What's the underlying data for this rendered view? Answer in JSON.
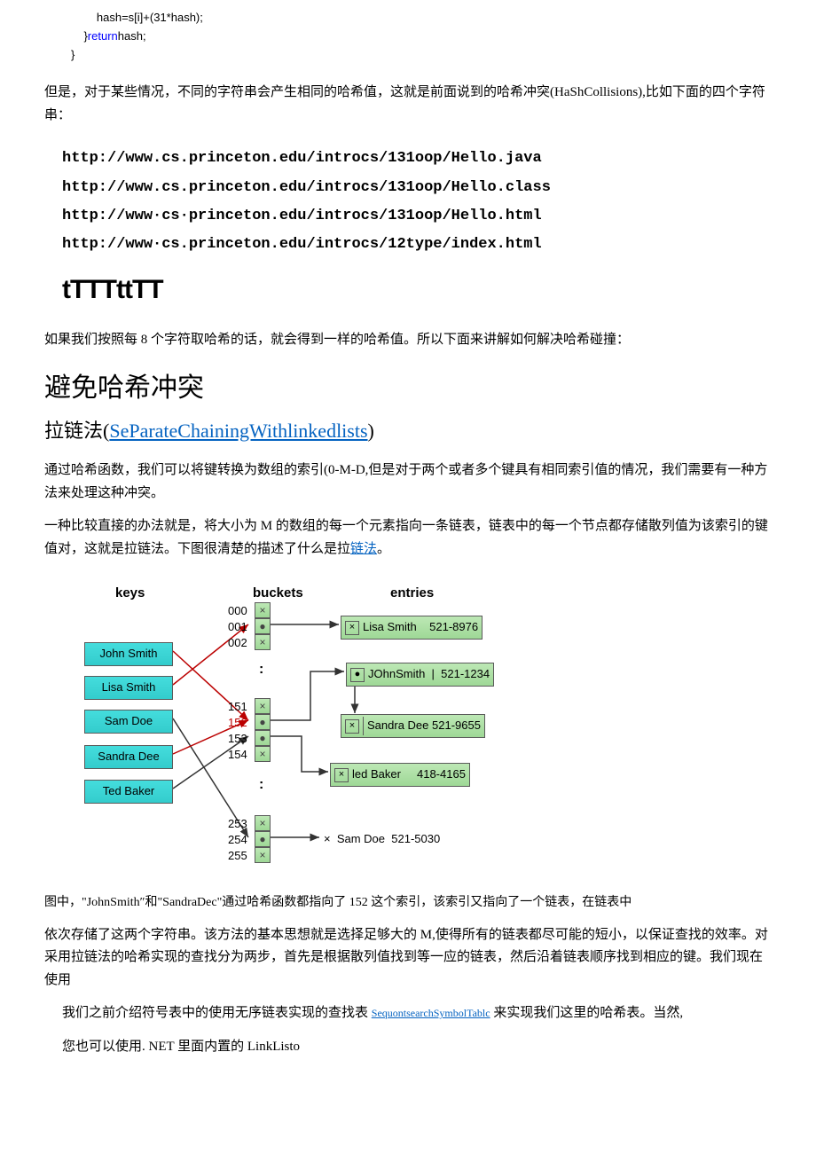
{
  "code": {
    "l1": "        hash=s[i]+(31*hash);",
    "l2": "    }",
    "ret": "return",
    "l2b": "hash;",
    "l3": "}"
  },
  "para1": "但是，对于某些情况，不同的字符串会产生相同的哈希值，这就是前面说到的哈希冲突(HaShCollisions),比如下面的四个字符串：",
  "urls": {
    "u1": "http://www.cs.princeton.edu/introcs/131oop/Hello.java",
    "u2": "http://www.cs.princeton.edu/introcs/131oop/Hello.class",
    "u3": "http://www·cs·princeton.edu/introcs/131oop/Hello.html",
    "u4": "http://www·cs.princeton.edu/introcs/12type/index.html"
  },
  "ttt": "tTTTttTT",
  "para2": "如果我们按照每 8 个字符取哈希的话，就会得到一样的哈希值。所以下面来讲解如何解决哈希碰撞：",
  "h1": "避免哈希冲突",
  "h2_pre": "拉链法",
  "h2_link": "SeParateChainingWithlinkedlists",
  "para3": "通过哈希函数，我们可以将键转换为数组的索引(0-M-D,但是对于两个或者多个键具有相同索引值的情况，我们需要有一种方法来处理这种冲突。",
  "para4a": "一种比较直接的办法就是，将大小为 M 的数组的每一个元素指向一条链表，链表中的每一个节点都存储散列值为该索引的键值对，这就是拉链法。下图很清楚的描述了什么是拉",
  "para4_link": "链法",
  "para4b": "。",
  "diagram": {
    "hdr_keys": "keys",
    "hdr_buckets": "buckets",
    "hdr_entries": "entries",
    "keys": [
      "John Smith",
      "Lisa Smith",
      "Sam Doe",
      "Sandra Dee",
      "Ted Baker"
    ],
    "bucket_nums": [
      "000",
      "001",
      "002",
      "151",
      "152",
      "153",
      "154",
      "253",
      "254",
      "255"
    ],
    "entries": [
      {
        "name": "Lisa Smith",
        "num": "521-8976"
      },
      {
        "name": "JOhnSmith",
        "num": "521-1234"
      },
      {
        "name": "Sandra Dee",
        "num": "521-9655"
      },
      {
        "name": "led Baker",
        "num": "418-4165"
      },
      {
        "name": "Sam Doe",
        "num": "521-5030"
      }
    ],
    "x": "×",
    "dot": "●",
    "vdots": ":"
  },
  "caption": "图中，\"JohnSmith″和\"SandraDec\"通过哈希函数都指向了 152 这个索引，该索引又指向了一个链表，在链表中",
  "para5": "依次存储了这两个字符串。该方法的基本思想就是选择足够大的 M,使得所有的链表都尽可能的短小，以保证查找的效率。对采用拉链法的哈希实现的查找分为两步，首先是根据散列值找到等一应的链表，然后沿着链表顺序找到相应的键。我们现在使用",
  "para6a": "我们之前介绍符号表中的使用无序链表实现的查找表",
  "para6_link": "SequontsearchSymbolTablc",
  "para6b": "来实现我们这里的哈希表。当然,",
  "para7": "您也可以使用. NET 里面内置的 LinkListo"
}
